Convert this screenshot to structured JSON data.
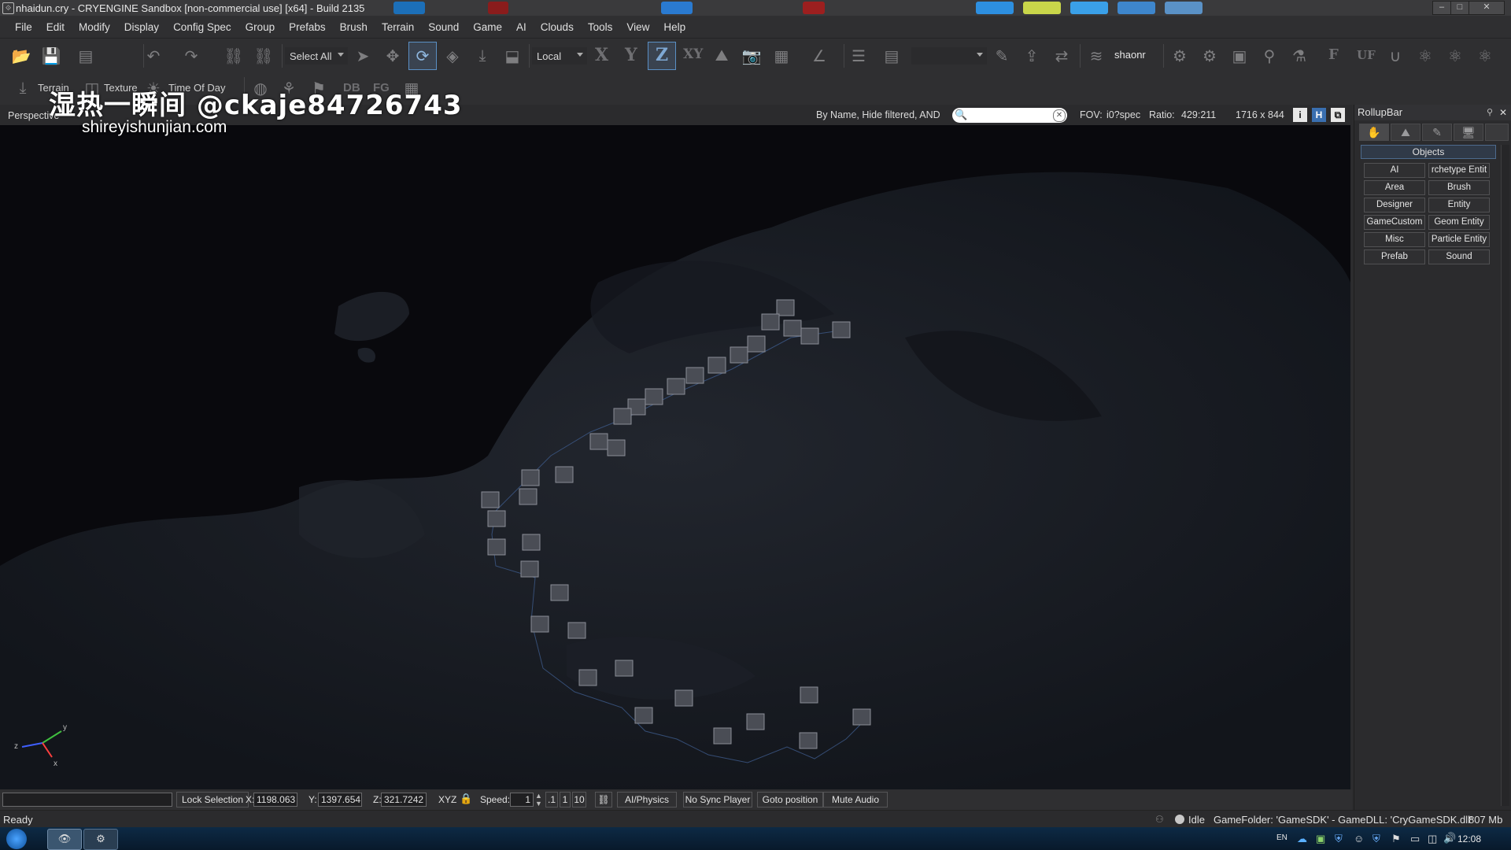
{
  "window": {
    "title": "nhaidun.cry - CRYENGINE Sandbox [non-commercial use] [x64] - Build 2135"
  },
  "menu": [
    "File",
    "Edit",
    "Modify",
    "Display",
    "Config Spec",
    "Group",
    "Prefabs",
    "Brush",
    "Terrain",
    "Sound",
    "Game",
    "AI",
    "Clouds",
    "Tools",
    "View",
    "Help"
  ],
  "toolbar": {
    "selection_value": "Select All",
    "coord_system_value": "Local",
    "axis_x": "X",
    "axis_y": "Y",
    "axis_z": "Z",
    "axis_xy": "XY",
    "layer_label": "shaonr",
    "ico_f": "F",
    "ico_uf": "UF"
  },
  "toolbar2": {
    "terrain_label": "Terrain",
    "texture_label": "Texture",
    "tod_label": "Time Of Day",
    "db": "DB",
    "fg": "FG"
  },
  "viewport": {
    "name": "Perspective",
    "filter_label": "By Name, Hide filtered, AND",
    "search_value": "",
    "fov": "FOV: ",
    "spec_text": "i0?spec",
    "ratio_label": "Ratio:",
    "ratio_value": "429:211",
    "resolution": "1716 x 844",
    "btn_i": "i",
    "btn_h": "H"
  },
  "gizmo": {
    "z": "z",
    "y": "y",
    "x": "x"
  },
  "rollup": {
    "title": "RollupBar",
    "section": "Objects",
    "buttons": [
      "AI",
      "rchetype Entit",
      "Area",
      "Brush",
      "Designer",
      "Entity",
      "GameCustom",
      "Geom Entity",
      "Misc",
      "Particle Entity",
      "Prefab",
      "Sound"
    ]
  },
  "bottombar": {
    "input_value": "",
    "lock_selection": "Lock Selection",
    "x_label": "X:",
    "x_value": "1198.063",
    "y_label": "Y:",
    "y_value": "1397.654",
    "z_label": "Z:",
    "z_value": "321.7242",
    "xyz_label": "XYZ",
    "speed_label": "Speed:",
    "speed_value": "1",
    "speed_01": ".1",
    "speed_1": "1",
    "speed_10": "10",
    "ai_physics": "AI/Physics",
    "no_sync": "No Sync Player",
    "goto": "Goto position",
    "mute": "Mute Audio"
  },
  "status": {
    "ready": "Ready",
    "idle": "Idle",
    "game_folder": "GameFolder: 'GameSDK' - GameDLL: 'CryGameSDK.dll'",
    "memory": "807 Mb"
  },
  "taskbar": {
    "lang": "EN",
    "clock": "12:08"
  },
  "watermark": {
    "line1": "湿热一瞬间 @ckaje84726743",
    "line2": "shireyishunjian.com"
  },
  "colors": {
    "accent": "#5a8fc4",
    "viewport_bg": "#0b0b0f",
    "ui_bg": "#2f2f31"
  }
}
